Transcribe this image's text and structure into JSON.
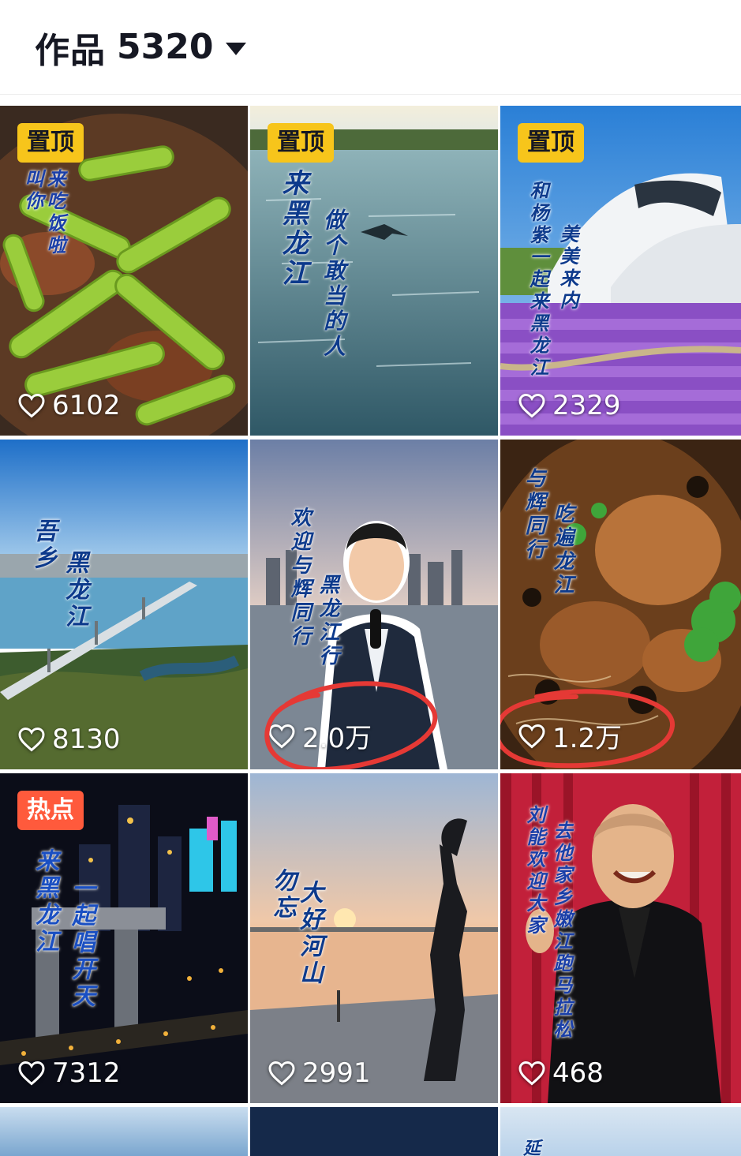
{
  "header": {
    "title": "作品",
    "count": "5320"
  },
  "colors": {
    "pin_badge": "#f7c51b",
    "hot_badge": "#ff5a3c",
    "annotation": "#e53935"
  },
  "tiles": [
    {
      "badge": "置顶",
      "likes": "6102",
      "texts": [
        "来吃饭啦",
        "叫你"
      ]
    },
    {
      "badge": "置顶",
      "likes": "",
      "texts": [
        "来黑龙江",
        "做个敢当的人"
      ]
    },
    {
      "badge": "置顶",
      "likes": "2329",
      "texts": [
        "和杨紫一起来黑龙江",
        "美美来内"
      ]
    },
    {
      "badge": "",
      "likes": "8130",
      "texts": [
        "吾乡",
        "黑龙江"
      ]
    },
    {
      "badge": "",
      "likes": "2.0万",
      "texts": [
        "欢迎与辉同行",
        "黑龙江行"
      ]
    },
    {
      "badge": "",
      "likes": "1.2万",
      "texts": [
        "与辉同行",
        "吃遍龙江"
      ]
    },
    {
      "badge": "热点",
      "likes": "7312",
      "texts": [
        "来黑龙江",
        "一起唱开天"
      ]
    },
    {
      "badge": "",
      "likes": "2991",
      "texts": [
        "勿忘",
        "大好河山"
      ]
    },
    {
      "badge": "",
      "likes": "468",
      "texts": [
        "刘能欢迎大家",
        "去他家乡嫩江跑马拉松"
      ]
    },
    {
      "badge": "",
      "likes": "",
      "texts": []
    },
    {
      "badge": "",
      "likes": "",
      "texts": []
    },
    {
      "badge": "",
      "likes": "",
      "texts": [
        "延"
      ]
    }
  ]
}
